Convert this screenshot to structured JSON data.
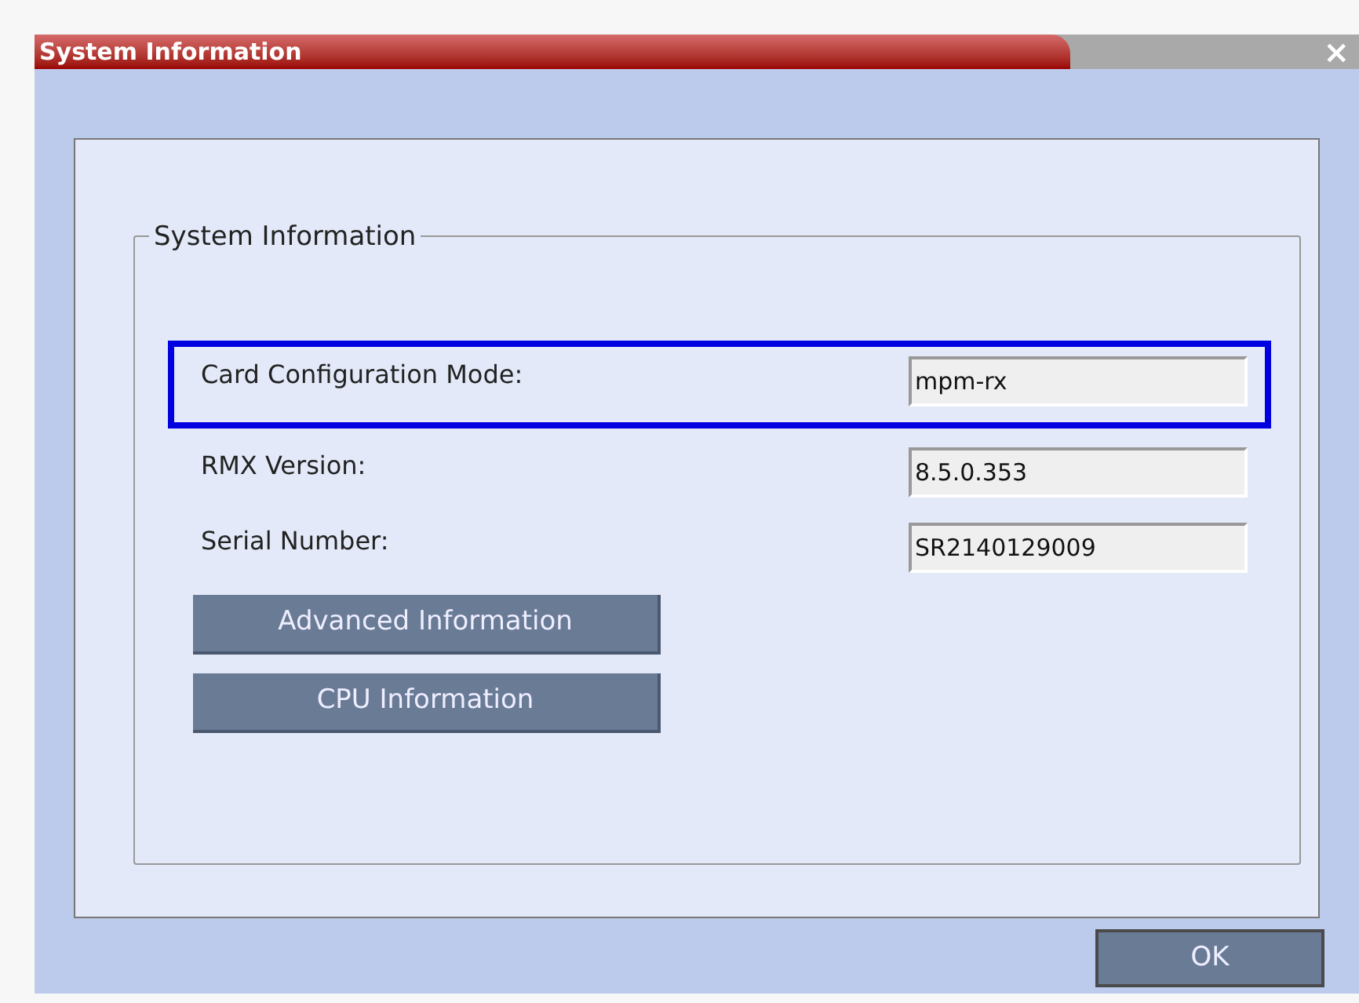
{
  "window": {
    "title": "System Information",
    "close": "×"
  },
  "group": {
    "title": "System Information"
  },
  "fields": [
    {
      "label": "Card Configuration Mode:",
      "value": "mpm-rx",
      "highlighted": true
    },
    {
      "label": "RMX Version:",
      "value": "8.5.0.353",
      "highlighted": false
    },
    {
      "label": "Serial Number:",
      "value": "SR2140129009",
      "highlighted": false
    }
  ],
  "buttons": [
    "Advanced Information",
    "CPU Information"
  ],
  "ok_button": "OK"
}
